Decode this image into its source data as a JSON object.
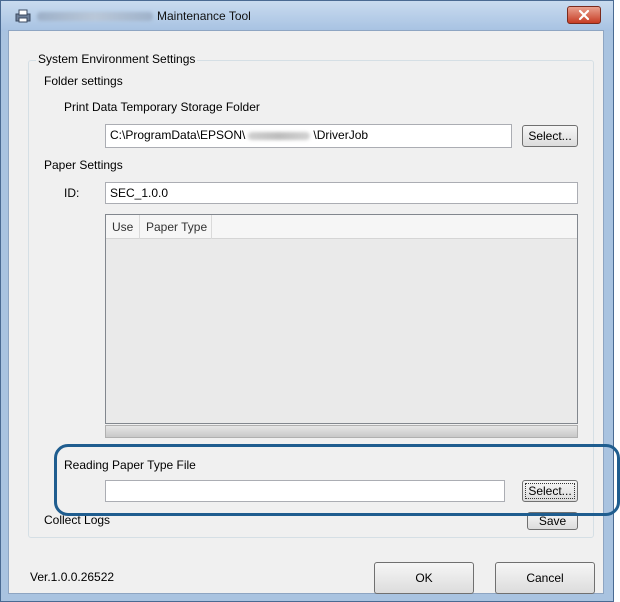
{
  "window": {
    "title": "Maintenance Tool"
  },
  "group": {
    "title": "System Environment Settings"
  },
  "folder_settings": {
    "heading": "Folder settings",
    "storage_label": "Print Data Temporary Storage Folder",
    "path_prefix": "C:\\ProgramData\\EPSON\\",
    "path_suffix": "\\DriverJob",
    "select_label": "Select..."
  },
  "paper_settings": {
    "heading": "Paper Settings",
    "id_label": "ID:",
    "id_value": "SEC_1.0.0",
    "columns": [
      "Use",
      "Paper Type"
    ]
  },
  "reading": {
    "label": "Reading Paper Type File",
    "value": "",
    "select_label": "Select..."
  },
  "collect_logs": {
    "label": "Collect Logs",
    "save_label": "Save"
  },
  "footer": {
    "version": "Ver.1.0.0.26522",
    "ok_label": "OK",
    "cancel_label": "Cancel"
  },
  "colors": {
    "highlight": "#1f5d8f",
    "close_button": "#c73c24"
  }
}
